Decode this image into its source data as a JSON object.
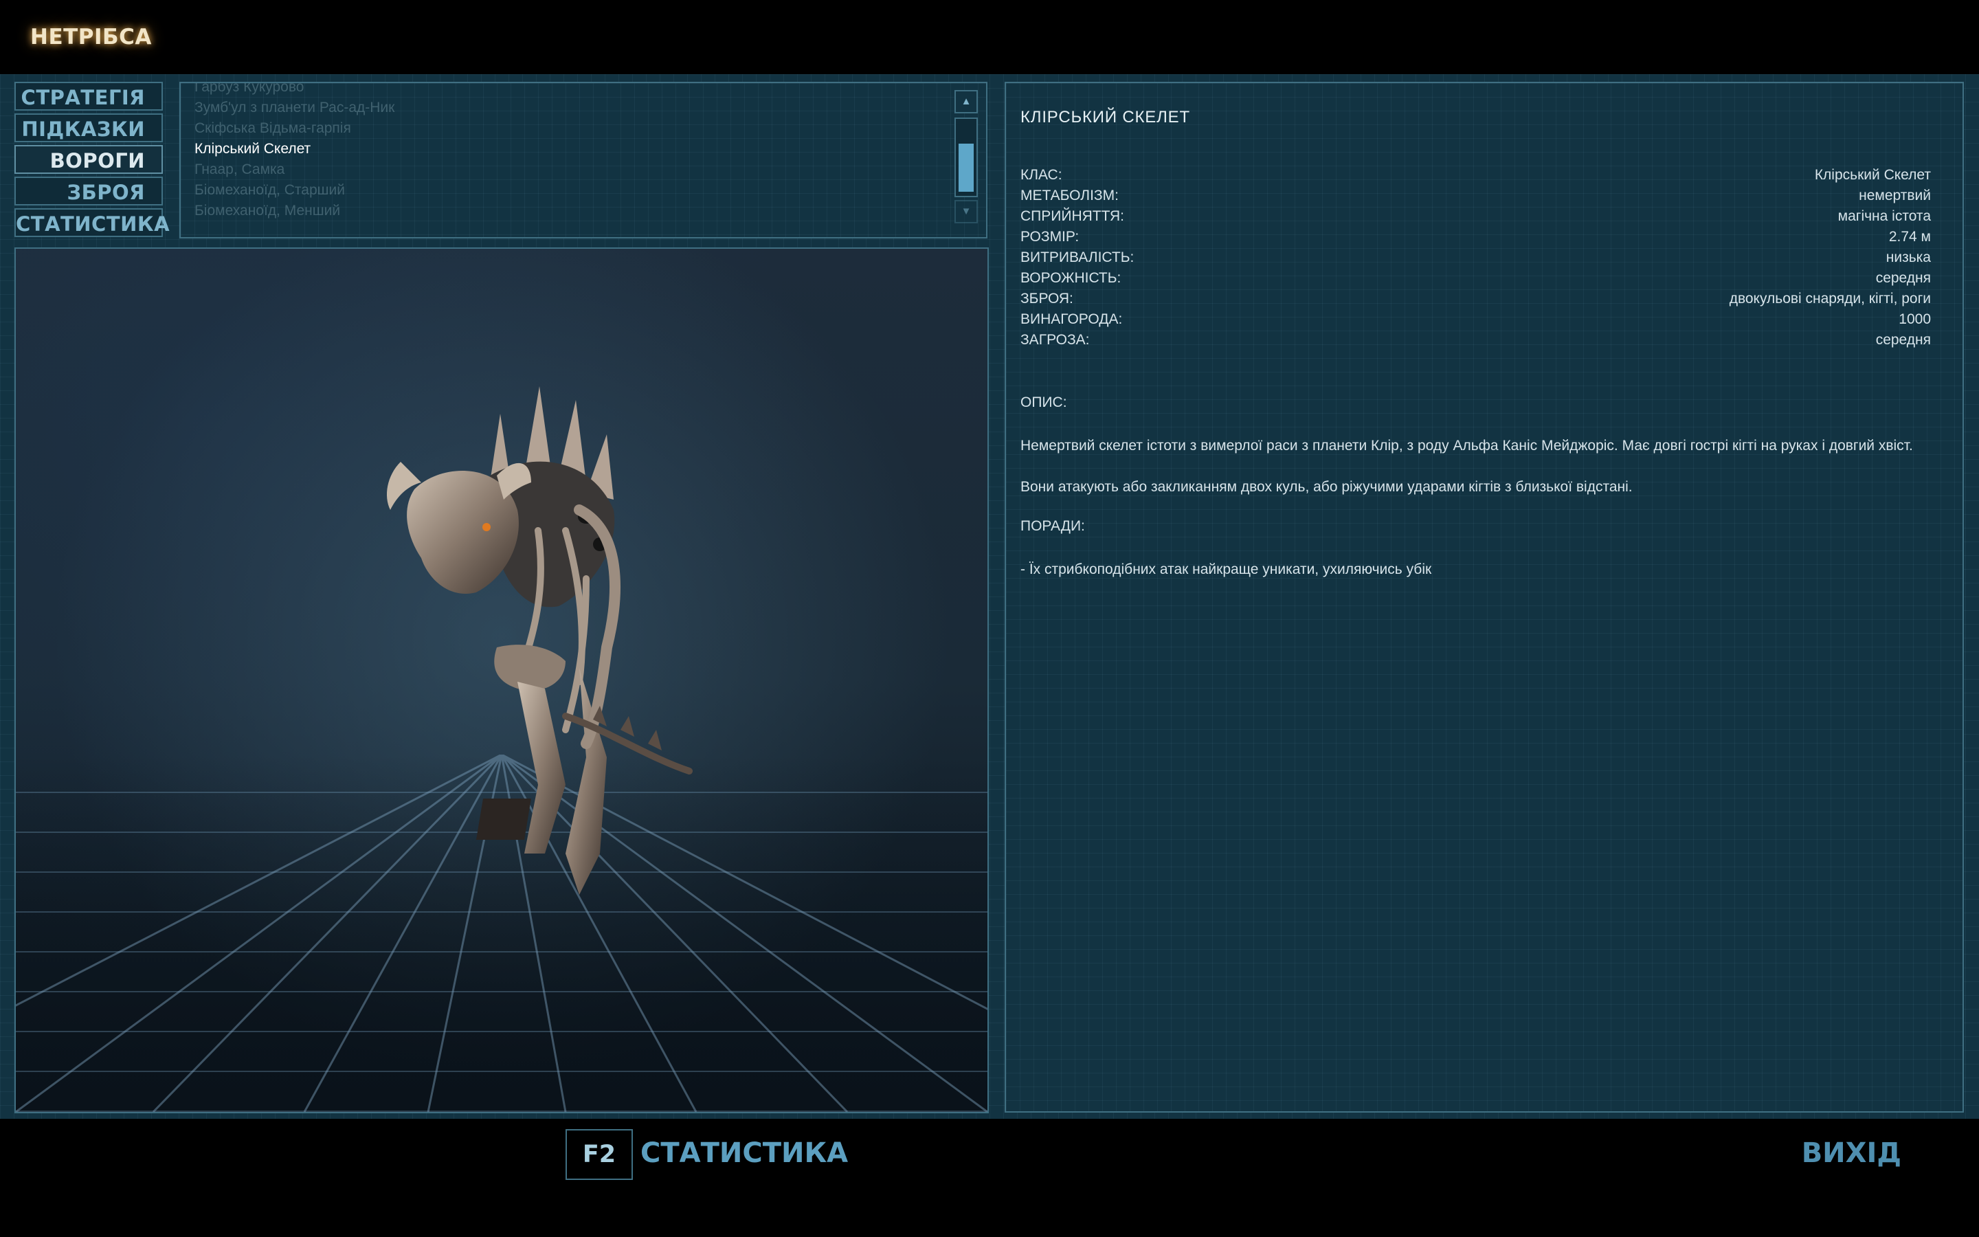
{
  "header": {
    "title": "НЕТРІБСА"
  },
  "nav": {
    "items": [
      {
        "label": "СТРАТЕГІЯ",
        "active": false
      },
      {
        "label": "ПІДКАЗКИ",
        "active": false
      },
      {
        "label": "ВОРОГИ",
        "active": true
      },
      {
        "label": "ЗБРОЯ",
        "active": false
      },
      {
        "label": "СТАТИСТИКА",
        "active": false
      }
    ]
  },
  "enemy_list": {
    "items": [
      {
        "label": "Гарбуз Кукурово",
        "state": "dim"
      },
      {
        "label": "Зумб'ул з планети Рас-ад-Ник",
        "state": "dim"
      },
      {
        "label": "Скіфська Відьма-гарпія",
        "state": "dim"
      },
      {
        "label": "Клірський Скелет",
        "state": "selected"
      },
      {
        "label": "Гнаар, Самка",
        "state": "dim"
      },
      {
        "label": "Біомеханоїд, Старший",
        "state": "dim"
      },
      {
        "label": "Біомеханоїд, Менший",
        "state": "dim"
      }
    ],
    "scroll_position": 0.45
  },
  "info": {
    "title": "КЛІРСЬКИЙ СКЕЛЕТ",
    "stats": [
      {
        "key": "КЛАС:",
        "value": "Клірський Скелет"
      },
      {
        "key": "МЕТАБОЛІЗМ:",
        "value": "немертвий"
      },
      {
        "key": "СПРИЙНЯТТЯ:",
        "value": "магічна істота"
      },
      {
        "key": "РОЗМІР:",
        "value": "2.74 м"
      },
      {
        "key": "ВИТРИВАЛІСТЬ:",
        "value": "низька"
      },
      {
        "key": "ВОРОЖНІСТЬ:",
        "value": "середня"
      },
      {
        "key": "ЗБРОЯ:",
        "value": "двокульові снаряди, кігті, роги"
      },
      {
        "key": "ВИНАГОРОДА:",
        "value": "1000"
      },
      {
        "key": "ЗАГРОЗА:",
        "value": "середня"
      }
    ],
    "description_label": "ОПИС:",
    "description_1": "Немертвий скелет істоти з вимерлої раси з планети Клір, з роду Альфа Каніс Мейджоріс. Має довгі гострі кігті на руках і довгий хвіст.",
    "description_2": "Вони атакують або закликанням двох куль, або ріжучими ударами кігтів з близької відстані.",
    "tips_label": "ПОРАДИ:",
    "tip_1": "- Їх стрибкоподібних атак найкраще уникати, ухиляючись убік"
  },
  "footer": {
    "f2_key": "F2",
    "f2_label": "СТАТИСТИКА",
    "exit_label": "ВИХІД"
  },
  "colors": {
    "accent": "#5c9fc0",
    "panel_border": "#3f6f82",
    "title_glow": "#f2e5c7"
  }
}
